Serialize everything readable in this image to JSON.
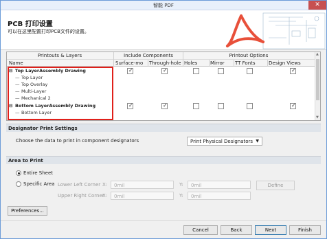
{
  "window": {
    "title": "智能 PDF",
    "close_glyph": "✕"
  },
  "header": {
    "title": "PCB 打印设置",
    "subtitle": "可以在这里配置打印PCB文件的设置。"
  },
  "table": {
    "groups": [
      "Printouts & Layers",
      "Include Components",
      "Printout Options"
    ],
    "columns": [
      "Name",
      "Surface-mo",
      "Through-hole",
      "Holes",
      "Mirror",
      "TT Fonts",
      "Design Views"
    ],
    "rows": [
      {
        "label": "Top LayerAssembly Drawing",
        "kind": "group",
        "checks": [
          true,
          true,
          false,
          false,
          false,
          true
        ]
      },
      {
        "label": "Top Layer",
        "kind": "child"
      },
      {
        "label": "Top Overlay",
        "kind": "child"
      },
      {
        "label": "Multi-Layer",
        "kind": "child"
      },
      {
        "label": "Mechanical 2",
        "kind": "child"
      },
      {
        "label": "Bottom LayerAssembly Drawing",
        "kind": "group",
        "checks": [
          true,
          true,
          false,
          false,
          false,
          true
        ]
      },
      {
        "label": "Bottom Layer",
        "kind": "child"
      }
    ]
  },
  "designator": {
    "section_title": "Designator Print Settings",
    "prompt": "Choose the data to print in component designators",
    "selected": "Print Physical Designators"
  },
  "area": {
    "section_title": "Area to Print",
    "entire_sheet": "Entire Sheet",
    "specific_area": "Specific Area",
    "lower_left": "Lower Left Corner",
    "upper_right": "Upper Right Corner",
    "x_label": "X:",
    "y_label": "Y:",
    "llx": "0mil",
    "lly": "0mil",
    "urx": "0mil",
    "ury": "0mil",
    "define": "Define"
  },
  "preferences": "Preferences...",
  "footer": {
    "cancel": "Cancel",
    "back": "Back",
    "next": "Next",
    "finish": "Finish"
  },
  "colors": {
    "highlight": "#e0201a",
    "accent": "#3c7fb1"
  }
}
